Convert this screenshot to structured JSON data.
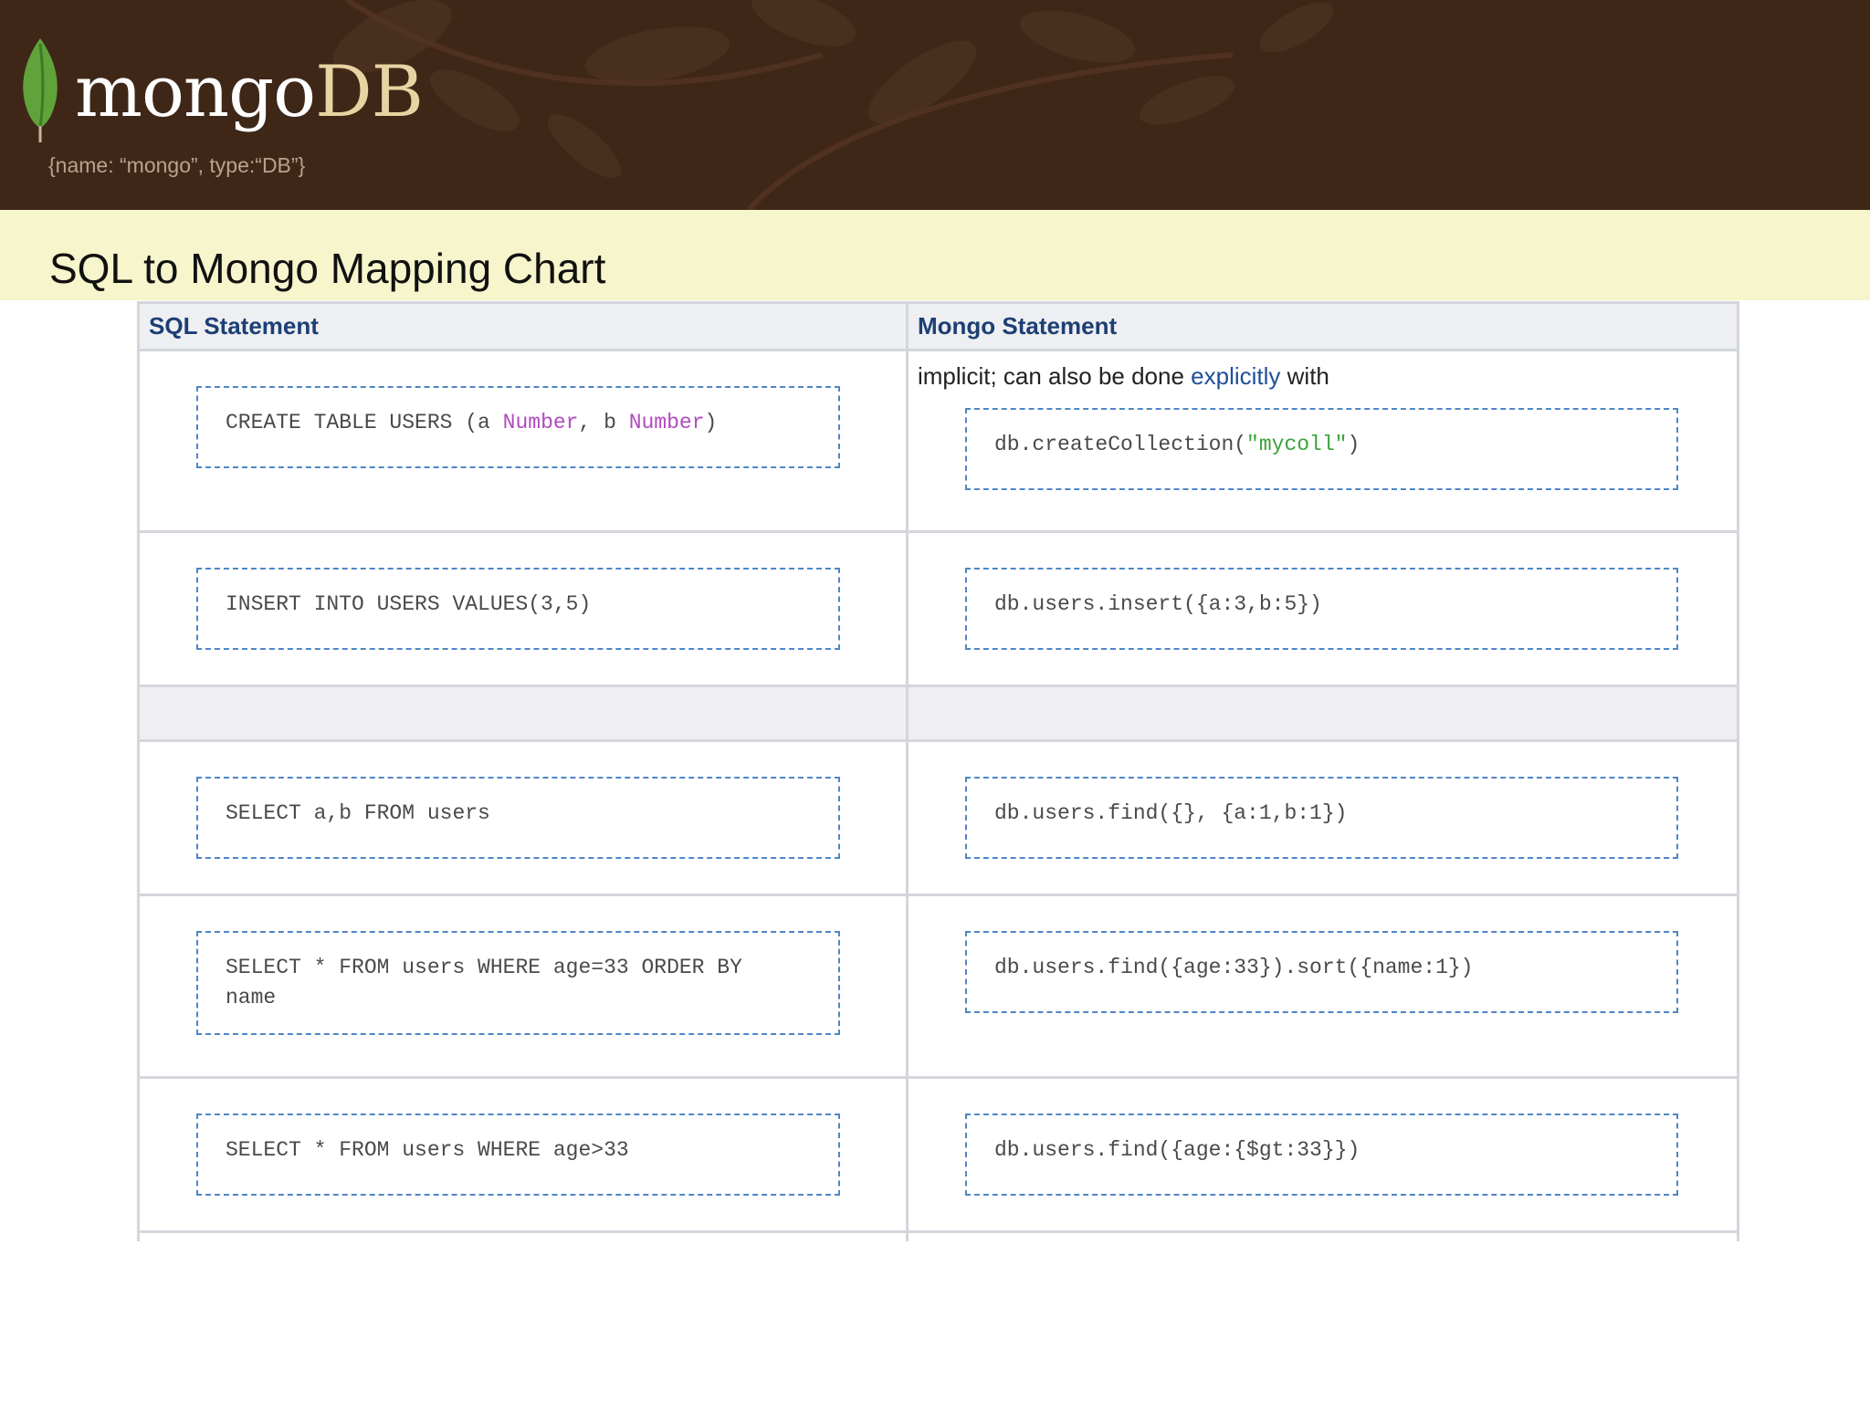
{
  "logo": {
    "name_part1": "mongo",
    "name_part2": "DB",
    "tagline": "{name: “mongo”, type:“DB”}"
  },
  "page": {
    "title": "SQL to Mongo Mapping Chart"
  },
  "table": {
    "headers": {
      "sql": "SQL Statement",
      "mongo": "Mongo Statement"
    },
    "row1": {
      "sql_parts": [
        "CREATE TABLE USERS (a ",
        "Number",
        ", b ",
        "Number",
        ")"
      ],
      "note_before": "implicit; can also be done ",
      "note_link": "explicitly",
      "note_after": " with",
      "mongo_parts": [
        "db.createCollection(",
        "\"mycoll\"",
        ")"
      ]
    },
    "row2": {
      "sql": "INSERT INTO USERS VALUES(3,5)",
      "mongo": "db.users.insert({a:3,b:5})"
    },
    "row3": {
      "sql": "SELECT a,b FROM users",
      "mongo": "db.users.find({}, {a:1,b:1})"
    },
    "row4": {
      "sql": "SELECT * FROM users WHERE age=33 ORDER BY\nname",
      "mongo": "db.users.find({age:33}).sort({name:1})"
    },
    "row5": {
      "sql": "SELECT * FROM users WHERE age>33",
      "mongo": "db.users.find({age:{$gt:33}})"
    }
  },
  "colors": {
    "banner": "#3f2718",
    "title_band": "#f6f5cb",
    "header_text": "#1c3f74",
    "code_border": "#4f86c6",
    "type_keyword": "#b04bbd",
    "string_literal": "#3aa33a"
  }
}
